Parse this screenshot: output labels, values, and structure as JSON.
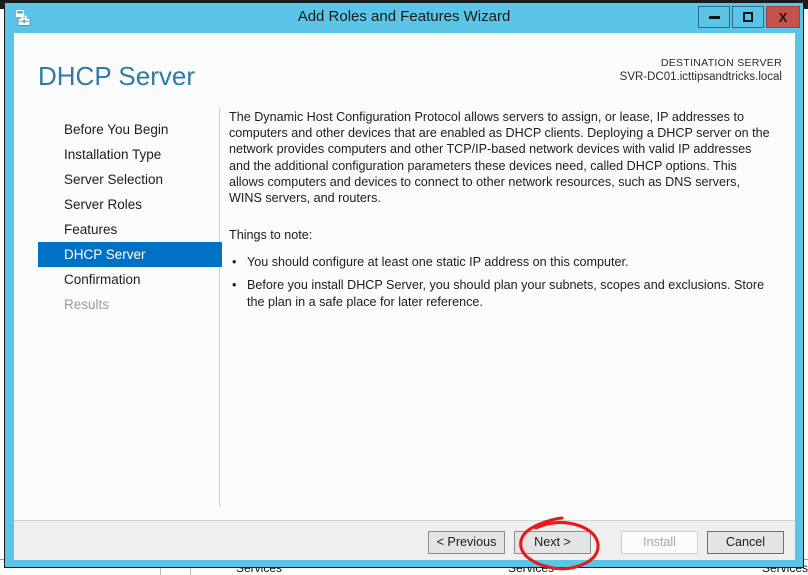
{
  "window": {
    "title": "Add Roles and Features Wizard",
    "icon": "toolbox-icon",
    "accent_color": "#5bc5e8",
    "controls": {
      "minimize_label": "Minimize",
      "maximize_label": "Maximize",
      "close_label": "X"
    }
  },
  "header": {
    "page_title": "DHCP Server",
    "title_color": "#2f7ba8",
    "destination_label": "DESTINATION SERVER",
    "destination_server": "SVR-DC01.icttipsandtricks.local"
  },
  "nav": {
    "active_color": "#0072c6",
    "items": [
      {
        "label": "Before You Begin",
        "state": "normal"
      },
      {
        "label": "Installation Type",
        "state": "normal"
      },
      {
        "label": "Server Selection",
        "state": "normal"
      },
      {
        "label": "Server Roles",
        "state": "normal"
      },
      {
        "label": "Features",
        "state": "normal"
      },
      {
        "label": "DHCP Server",
        "state": "active"
      },
      {
        "label": "Confirmation",
        "state": "normal"
      },
      {
        "label": "Results",
        "state": "disabled"
      }
    ]
  },
  "content": {
    "intro": "The Dynamic Host Configuration Protocol allows servers to assign, or lease, IP addresses to computers and other devices that are enabled as DHCP clients. Deploying a DHCP server on the network provides computers and other TCP/IP-based network devices with valid IP addresses and the additional configuration parameters these devices need, called DHCP options. This allows computers and devices to connect to other network resources, such as DNS servers, WINS servers, and routers.",
    "notes_title": "Things to note:",
    "bullet_glyph": "•",
    "notes": [
      "You should configure at least one static IP address on this computer.",
      "Before you install DHCP Server, you should plan your subnets, scopes and exclusions. Store the plan in a safe place for later reference."
    ]
  },
  "footer": {
    "previous_label": "< Previous",
    "next_label": "Next >",
    "install_label": "Install",
    "install_enabled": false,
    "cancel_label": "Cancel"
  },
  "annotation": {
    "type": "hand-drawn-circle",
    "color": "#e8191b",
    "target": "Next >"
  },
  "background": {
    "services_label_1": "Services",
    "services_label_2": "Services",
    "services_label_3": "Services"
  }
}
